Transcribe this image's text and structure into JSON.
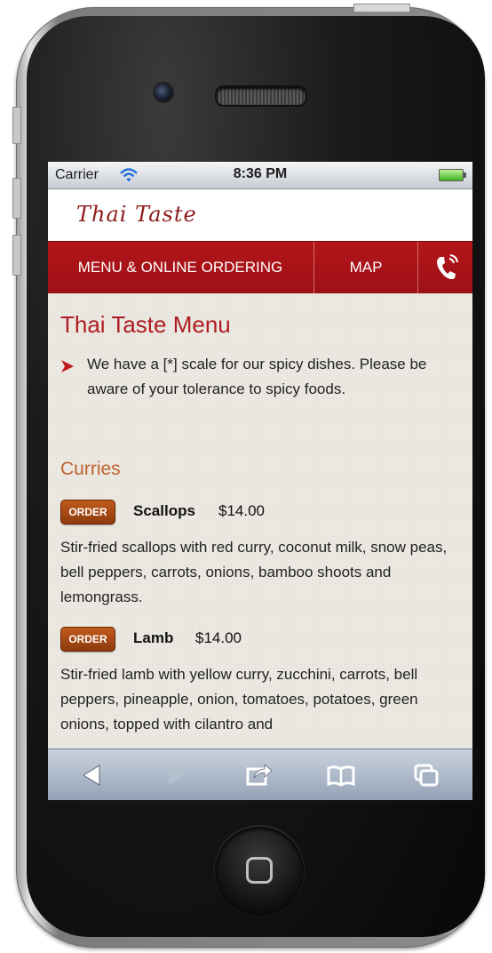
{
  "status_bar": {
    "carrier": "Carrier",
    "time": "8:36 PM",
    "wifi_icon": "wifi-icon",
    "battery_icon": "battery-icon"
  },
  "site": {
    "logo_text": "Thai Taste"
  },
  "nav": {
    "items": [
      {
        "label": "MENU & ONLINE ORDERING"
      },
      {
        "label": "MAP"
      }
    ],
    "call_icon": "phone-icon"
  },
  "page": {
    "title": "Thai Taste Menu",
    "notice": "We have a [*] scale for our spicy dishes. Please be aware of your tolerance to spicy foods.",
    "section": "Curries",
    "dishes": [
      {
        "order_label": "ORDER",
        "name": "Scallops",
        "price": "$14.00",
        "description": "Stir-fried scallops with red curry, coconut milk, snow peas, bell peppers, carrots, onions, bamboo shoots and lemongrass."
      },
      {
        "order_label": "ORDER",
        "name": "Lamb",
        "price": "$14.00",
        "description": "Stir-fried lamb with yellow curry, zucchini, carrots, bell peppers, pineapple, onion, tomatoes, potatoes, green onions, topped with cilantro and"
      }
    ]
  },
  "toolbar": {
    "buttons": [
      "back-icon",
      "forward-icon",
      "share-icon",
      "bookmarks-icon",
      "tabs-icon"
    ]
  },
  "colors": {
    "accent_red": "#b01c21",
    "section_orange": "#c0622e",
    "order_brown": "#a24612"
  }
}
